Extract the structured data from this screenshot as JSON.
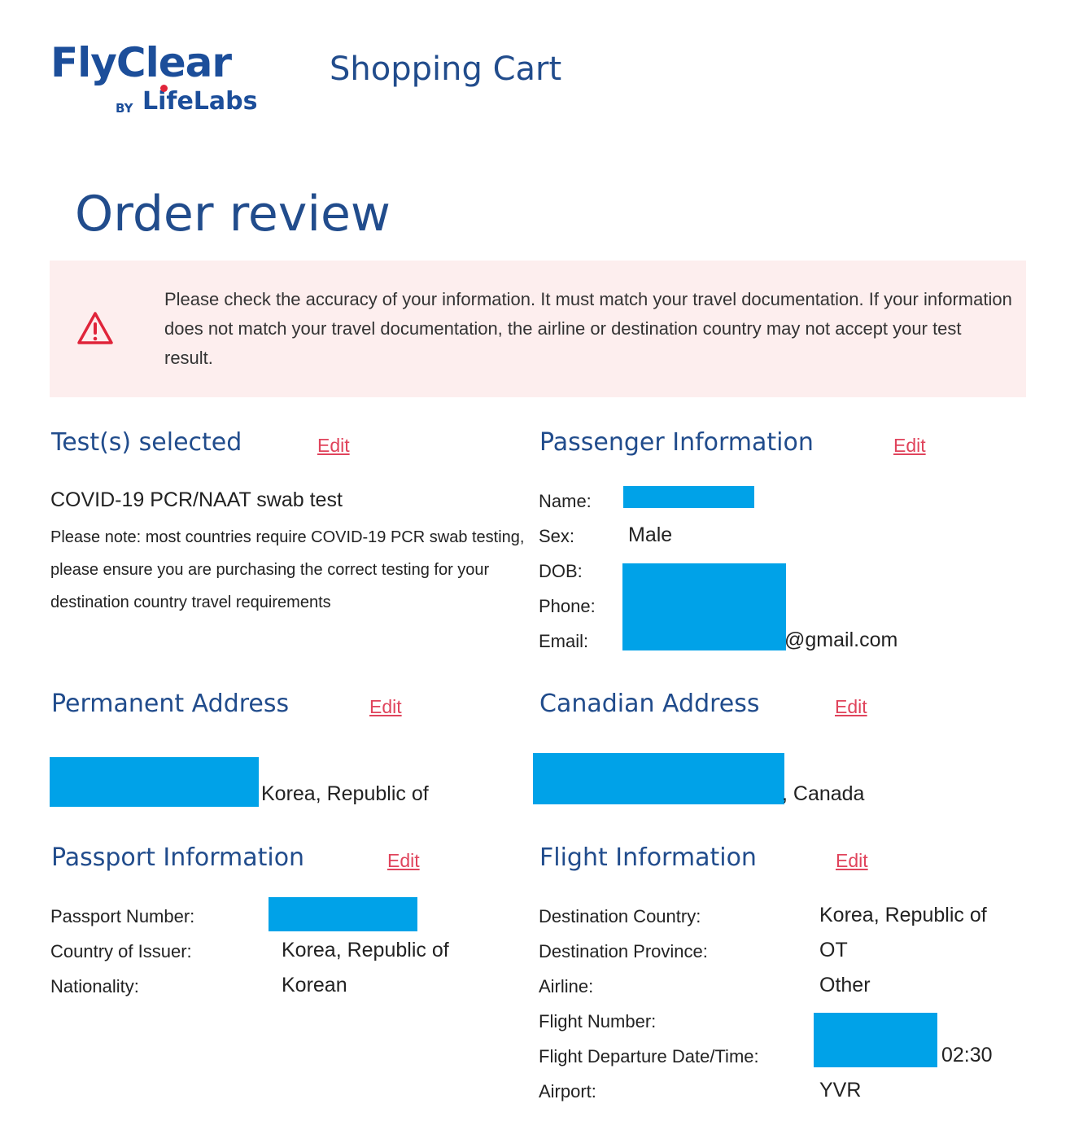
{
  "logo": {
    "name": "FlyClear",
    "by": "BY",
    "brand": "LifeLabs"
  },
  "header": {
    "title": "Shopping Cart"
  },
  "page_title": "Order review",
  "alert": {
    "text": "Please check the accuracy of your information. It must match your travel documentation. If your information does not match your travel documentation, the airline or destination country may not accept your test result."
  },
  "edit_label": "Edit",
  "tests": {
    "heading": "Test(s) selected",
    "test_name": "COVID-19 PCR/NAAT swab test",
    "note": "Please note: most countries require COVID-19 PCR swab testing, please ensure you are purchasing the correct testing for your destination country travel requirements"
  },
  "passenger": {
    "heading": "Passenger Information",
    "name_label": "Name:",
    "sex_label": "Sex:",
    "sex_value": "Male",
    "dob_label": "DOB:",
    "phone_label": "Phone:",
    "email_label": "Email:",
    "email_suffix": "@gmail.com"
  },
  "permanent_address": {
    "heading": "Permanent Address",
    "suffix": "Korea, Republic of"
  },
  "canadian_address": {
    "heading": "Canadian Address",
    "suffix": ", Canada"
  },
  "passport": {
    "heading": "Passport Information",
    "number_label": "Passport Number:",
    "issuer_label": "Country of Issuer:",
    "issuer_value": "Korea, Republic of",
    "nationality_label": "Nationality:",
    "nationality_value": "Korean"
  },
  "flight": {
    "heading": "Flight Information",
    "dest_country_label": "Destination Country:",
    "dest_country_value": "Korea, Republic of",
    "dest_province_label": "Destination Province:",
    "dest_province_value": "OT",
    "airline_label": "Airline:",
    "airline_value": "Other",
    "flight_number_label": "Flight Number:",
    "departure_label": "Flight Departure Date/Time:",
    "departure_time_suffix": "02:30",
    "airport_label": "Airport:",
    "airport_value": "YVR"
  },
  "colors": {
    "brand_blue": "#214c8c",
    "edit_red": "#e0445c",
    "alert_bg": "#fdeeee",
    "redaction": "#00a2e8"
  }
}
